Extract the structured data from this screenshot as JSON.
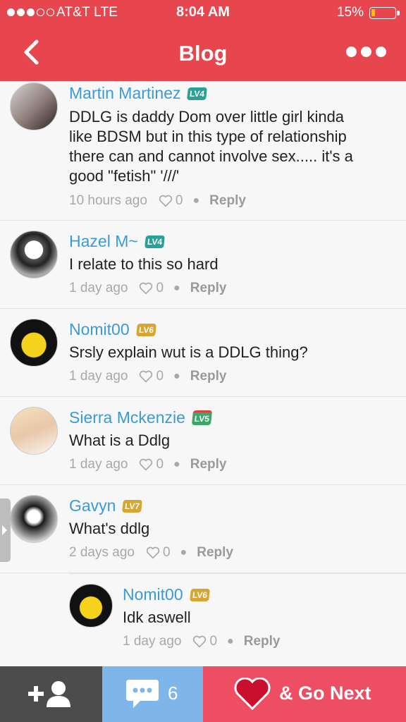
{
  "status_bar": {
    "carrier": "AT&T  LTE",
    "time": "8:04 AM",
    "battery_percent": "15%",
    "battery_level": 0.15,
    "signal_bars_filled": 3,
    "signal_bars_total": 5
  },
  "header": {
    "title": "Blog",
    "back_icon": "chevron-left-icon",
    "more_icon": "more-dots-icon",
    "color": "#e8464f"
  },
  "comments": [
    {
      "name": "Martin Martinez",
      "level": "LV4",
      "text_lines": [
        "DDLG is daddy Dom over little girl kinda",
        "like BDSM but in this type of relationship",
        "there can and cannot involve sex..... it's a",
        "good \"fetish\" '///'"
      ],
      "time": "10 hours ago",
      "likes": "0",
      "reply": "Reply"
    },
    {
      "name": "Hazel M~",
      "level": "LV4",
      "text_lines": [
        "I relate to this so hard"
      ],
      "time": "1 day ago",
      "likes": "0",
      "reply": "Reply"
    },
    {
      "name": "Nomit00",
      "level": "LV6",
      "text_lines": [
        "Srsly explain wut is a DDLG thing?"
      ],
      "time": "1 day ago",
      "likes": "0",
      "reply": "Reply"
    },
    {
      "name": "Sierra Mckenzie",
      "level": "LV5",
      "text_lines": [
        "What is a Ddlg"
      ],
      "time": "1 day ago",
      "likes": "0",
      "reply": "Reply"
    },
    {
      "name": "Gavyn",
      "level": "LV7",
      "text_lines": [
        "What's ddlg"
      ],
      "time": "2 days ago",
      "likes": "0",
      "reply": "Reply"
    },
    {
      "name": "Nomit00",
      "level": "LV6",
      "text_lines": [
        "Idk aswell"
      ],
      "time": "1 day ago",
      "likes": "0",
      "reply": "Reply"
    }
  ],
  "bottom_bar": {
    "follow_icon": "add-user-icon",
    "comment_icon": "comment-bubble-icon",
    "comment_count": "6",
    "next_icon": "heart-icon",
    "next_label": "& Go Next"
  }
}
